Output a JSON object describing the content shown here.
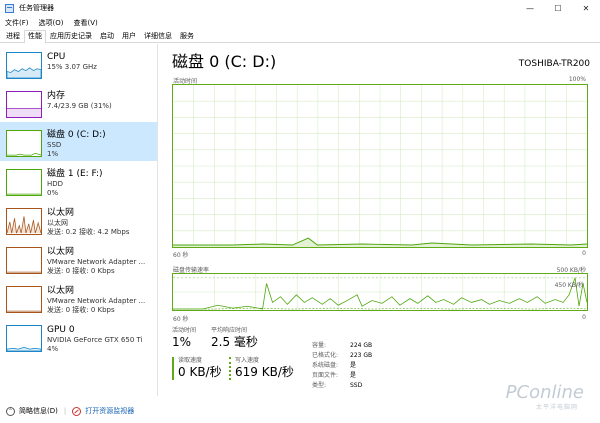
{
  "window": {
    "title": "任务管理器",
    "buttons": [
      "—",
      "☐",
      "✕"
    ]
  },
  "menu": [
    "文件(F)",
    "选项(O)",
    "查看(V)"
  ],
  "tabs": [
    {
      "label": "进程",
      "active": false
    },
    {
      "label": "性能",
      "active": true
    },
    {
      "label": "应用历史记录",
      "active": false
    },
    {
      "label": "启动",
      "active": false
    },
    {
      "label": "用户",
      "active": false
    },
    {
      "label": "详细信息",
      "active": false
    },
    {
      "label": "服务",
      "active": false
    }
  ],
  "sidebar": {
    "items": [
      {
        "title": "CPU",
        "sub1": "15% 3.07 GHz",
        "sub2": "",
        "icon": "cpu-graph-icon",
        "color": "#1b86c7",
        "selected": false
      },
      {
        "title": "内存",
        "sub1": "7.4/23.9 GB (31%)",
        "sub2": "",
        "icon": "memory-graph-icon",
        "color": "#8b1db8",
        "selected": false
      },
      {
        "title": "磁盘 0 (C: D:)",
        "sub1": "SSD",
        "sub2": "1%",
        "icon": "disk-graph-icon",
        "color": "#4da60c",
        "selected": true
      },
      {
        "title": "磁盘 1 (E: F:)",
        "sub1": "HDD",
        "sub2": "0%",
        "icon": "disk-graph-icon",
        "color": "#4da60c",
        "selected": false
      },
      {
        "title": "以太网",
        "sub1": "以太网",
        "sub2": "发送: 0.2 接收: 4.2 Mbps",
        "icon": "ethernet-graph-icon",
        "color": "#a6551c",
        "selected": false
      },
      {
        "title": "以太网",
        "sub1": "VMware Network Adapter ...",
        "sub2": "发送: 0 接收: 0 Kbps",
        "icon": "ethernet-graph-icon",
        "color": "#a6551c",
        "selected": false
      },
      {
        "title": "以太网",
        "sub1": "VMware Network Adapter ...",
        "sub2": "发送: 0 接收: 0 Kbps",
        "icon": "ethernet-graph-icon",
        "color": "#a6551c",
        "selected": false
      },
      {
        "title": "GPU 0",
        "sub1": "NVIDIA GeForce GTX 650 Ti",
        "sub2": "4%",
        "icon": "gpu-graph-icon",
        "color": "#1b86c7",
        "selected": false
      }
    ]
  },
  "main": {
    "title": "磁盘 0 (C: D:)",
    "model": "TOSHIBA-TR200",
    "activity_graph": {
      "label": "活动时间",
      "max_label": "100%",
      "time_label": "60 秒",
      "min_label": "0"
    },
    "transfer_graph": {
      "label": "磁盘传输速率",
      "max_label": "500 KB/秒",
      "mid_label": "450 KB/秒",
      "time_label": "60 秒",
      "min_label": "0"
    },
    "stats": {
      "active_time": {
        "label": "活动时间",
        "value": "1%"
      },
      "response_time": {
        "label": "平均响应时间",
        "value": "2.5 毫秒"
      },
      "read_speed": {
        "label": "读取速度",
        "value": "0 KB/秒"
      },
      "write_speed": {
        "label": "写入速度",
        "value": "619 KB/秒"
      }
    },
    "info": [
      {
        "key": "容量:",
        "value": "224 GB"
      },
      {
        "key": "已格式化:",
        "value": "223 GB"
      },
      {
        "key": "系统磁盘:",
        "value": "是"
      },
      {
        "key": "页面文件:",
        "value": "是"
      },
      {
        "key": "类型:",
        "value": "SSD"
      }
    ]
  },
  "footer": {
    "fewer_details": "简略信息(D)",
    "open_monitor": "打开资源监视器"
  },
  "watermark": {
    "brand": "PConline",
    "sub": "太平洋电脑网"
  }
}
